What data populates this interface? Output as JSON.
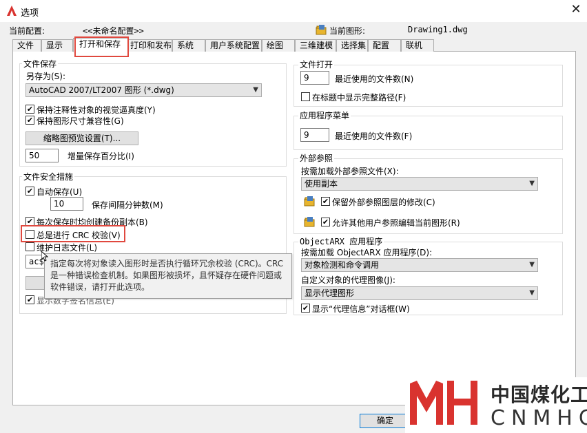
{
  "window": {
    "title": "选项",
    "close": "✕"
  },
  "profile": {
    "current_profile_label": "当前配置:",
    "current_profile_value": "<<未命名配置>>",
    "current_drawing_label": "当前图形:",
    "current_drawing_value": "Drawing1.dwg"
  },
  "tabs": [
    {
      "label": "文件"
    },
    {
      "label": "显示"
    },
    {
      "label": "打开和保存"
    },
    {
      "label": "打印和发布"
    },
    {
      "label": "系统"
    },
    {
      "label": "用户系统配置"
    },
    {
      "label": "绘图"
    },
    {
      "label": "三维建模"
    },
    {
      "label": "选择集"
    },
    {
      "label": "配置"
    },
    {
      "label": "联机"
    }
  ],
  "file_save": {
    "title": "文件保存",
    "save_as_label": "另存为(S):",
    "save_as_value": "AutoCAD 2007/LT2007 图形 (*.dwg)",
    "maintain_visual_fidelity": "保持注释性对象的视觉逼真度(Y)",
    "maintain_drawing_size": "保持图形尺寸兼容性(G)",
    "thumbnail_button": "缩略图预览设置(T)...",
    "incremental_value": "50",
    "incremental_label": "增量保存百分比(I)"
  },
  "file_safety": {
    "title": "文件安全措施",
    "autosave_label": "自动保存(U)",
    "autosave_minutes_value": "10",
    "autosave_minutes_label": "保存间隔分钟数(M)",
    "backup_label": "每次保存时均创建备份副本(B)",
    "crc_label": "总是进行 CRC 校验(V)",
    "log_label": "维护日志文件(L)",
    "temp_ext_value": "ac$",
    "digital_signature_label": "显示数字签名信息(E)"
  },
  "tooltip": {
    "text": "指定每次将对象读入图形时是否执行循环冗余校验 (CRC)。CRC 是一种错误检查机制。如果图形被损坏，且怀疑存在硬件问题或软件错误，请打开此选项。"
  },
  "file_open": {
    "title": "文件打开",
    "recent_value": "9",
    "recent_label": "最近使用的文件数(N)",
    "full_path_label": "在标题中显示完整路径(F)"
  },
  "app_menu": {
    "title": "应用程序菜单",
    "recent_value": "9",
    "recent_label": "最近使用的文件数(F)"
  },
  "xref": {
    "title": "外部参照",
    "demand_load_label": "按需加载外部参照文件(X):",
    "demand_load_value": "使用副本",
    "retain_changes_label": "保留外部参照图层的修改(C)",
    "allow_edit_label": "允许其他用户参照编辑当前图形(R)"
  },
  "objectarx": {
    "title": "ObjectARX 应用程序",
    "demand_load_label": "按需加载 ObjectARX 应用程序(D):",
    "demand_load_value": "对象检测和命令调用",
    "proxy_images_label": "自定义对象的代理图像(J):",
    "proxy_images_value": "显示代理图形",
    "show_proxy_dialog_label": "显示“代理信息”对话框(W)"
  },
  "buttons": {
    "ok": "确定"
  },
  "watermark": {
    "cn": "中国煤化工",
    "en": "CNMHG"
  },
  "colors": {
    "accent_red": "#e0483e",
    "brand_red": "#d9332f"
  }
}
